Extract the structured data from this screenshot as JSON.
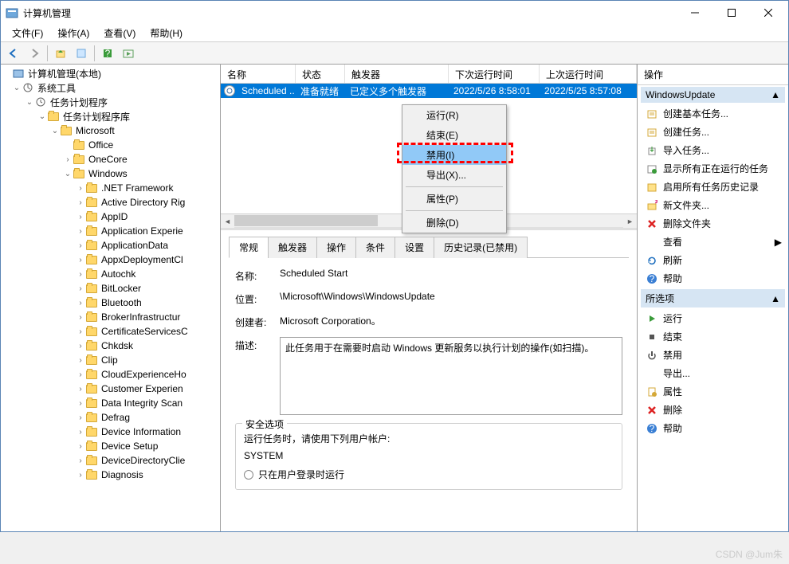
{
  "window": {
    "title": "计算机管理"
  },
  "menubar": [
    "文件(F)",
    "操作(A)",
    "查看(V)",
    "帮助(H)"
  ],
  "tree": {
    "root": "计算机管理(本地)",
    "system_tools": "系统工具",
    "task_scheduler": "任务计划程序",
    "task_library": "任务计划程序库",
    "microsoft": "Microsoft",
    "office": "Office",
    "onecore": "OneCore",
    "windows": "Windows",
    "items": [
      ".NET Framework",
      "Active Directory Rig",
      "AppID",
      "Application Experie",
      "ApplicationData",
      "AppxDeploymentCl",
      "Autochk",
      "BitLocker",
      "Bluetooth",
      "BrokerInfrastructur",
      "CertificateServicesC",
      "Chkdsk",
      "Clip",
      "CloudExperienceHo",
      "Customer Experien",
      "Data Integrity Scan",
      "Defrag",
      "Device Information",
      "Device Setup",
      "DeviceDirectoryClie",
      "Diagnosis"
    ]
  },
  "task_table": {
    "cols": {
      "name": "名称",
      "status": "状态",
      "trigger": "触发器",
      "next": "下次运行时间",
      "last": "上次运行时间"
    },
    "row": {
      "name": "Scheduled ...",
      "status": "准备就绪",
      "trigger": "已定义多个触发器",
      "next": "2022/5/26 8:58:01",
      "last": "2022/5/25 8:57:08"
    }
  },
  "context_menu": [
    "运行(R)",
    "结束(E)",
    "禁用(I)",
    "导出(X)...",
    "属性(P)",
    "删除(D)"
  ],
  "tabs": [
    "常规",
    "触发器",
    "操作",
    "条件",
    "设置",
    "历史记录(已禁用)"
  ],
  "detail": {
    "name_label": "名称:",
    "name_value": "Scheduled Start",
    "location_label": "位置:",
    "location_value": "\\Microsoft\\Windows\\WindowsUpdate",
    "author_label": "创建者:",
    "author_value": "Microsoft Corporation。",
    "desc_label": "描述:",
    "desc_value": "此任务用于在需要时启动 Windows 更新服务以执行计划的操作(如扫描)。",
    "security_legend": "安全选项",
    "security_user_label": "运行任务时，请使用下列用户帐户:",
    "security_user": "SYSTEM",
    "radio1": "只在用户登录时运行"
  },
  "actions": {
    "title": "操作",
    "header1": "WindowsUpdate",
    "group1": [
      "创建基本任务...",
      "创建任务...",
      "导入任务...",
      "显示所有正在运行的任务",
      "启用所有任务历史记录",
      "新文件夹...",
      "删除文件夹",
      "查看",
      "刷新",
      "帮助"
    ],
    "header2": "所选项",
    "group2": [
      "运行",
      "结束",
      "禁用",
      "导出...",
      "属性",
      "删除",
      "帮助"
    ]
  },
  "watermark": "CSDN @Jum朱"
}
